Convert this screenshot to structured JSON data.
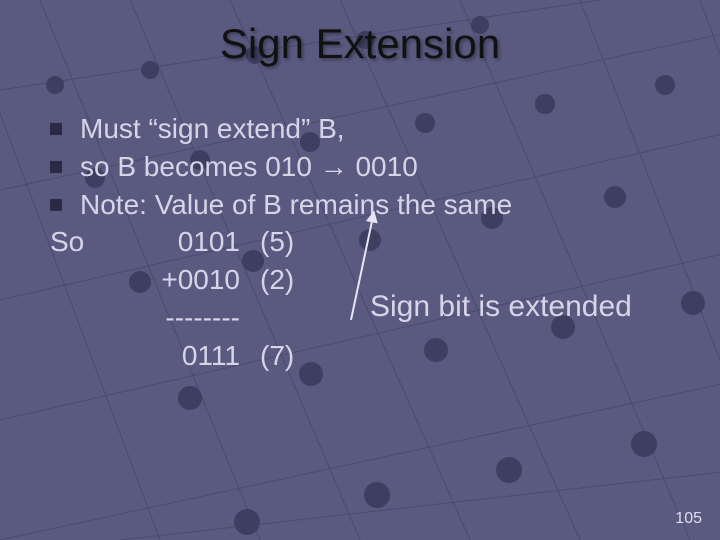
{
  "title": "Sign Extension",
  "bullets": {
    "b1": "Must “sign extend” B,",
    "b2": "so B becomes 010 → 0010",
    "b3": "Note: Value of B remains the same"
  },
  "calc": {
    "so": "So",
    "line1_num": "0101",
    "line1_par": "(5)",
    "line2_num": "+0010",
    "line2_par": "(2)",
    "rule": "--------",
    "line3_num": "0111",
    "line3_par": "(7)"
  },
  "callout": "Sign bit is extended",
  "page": "105"
}
